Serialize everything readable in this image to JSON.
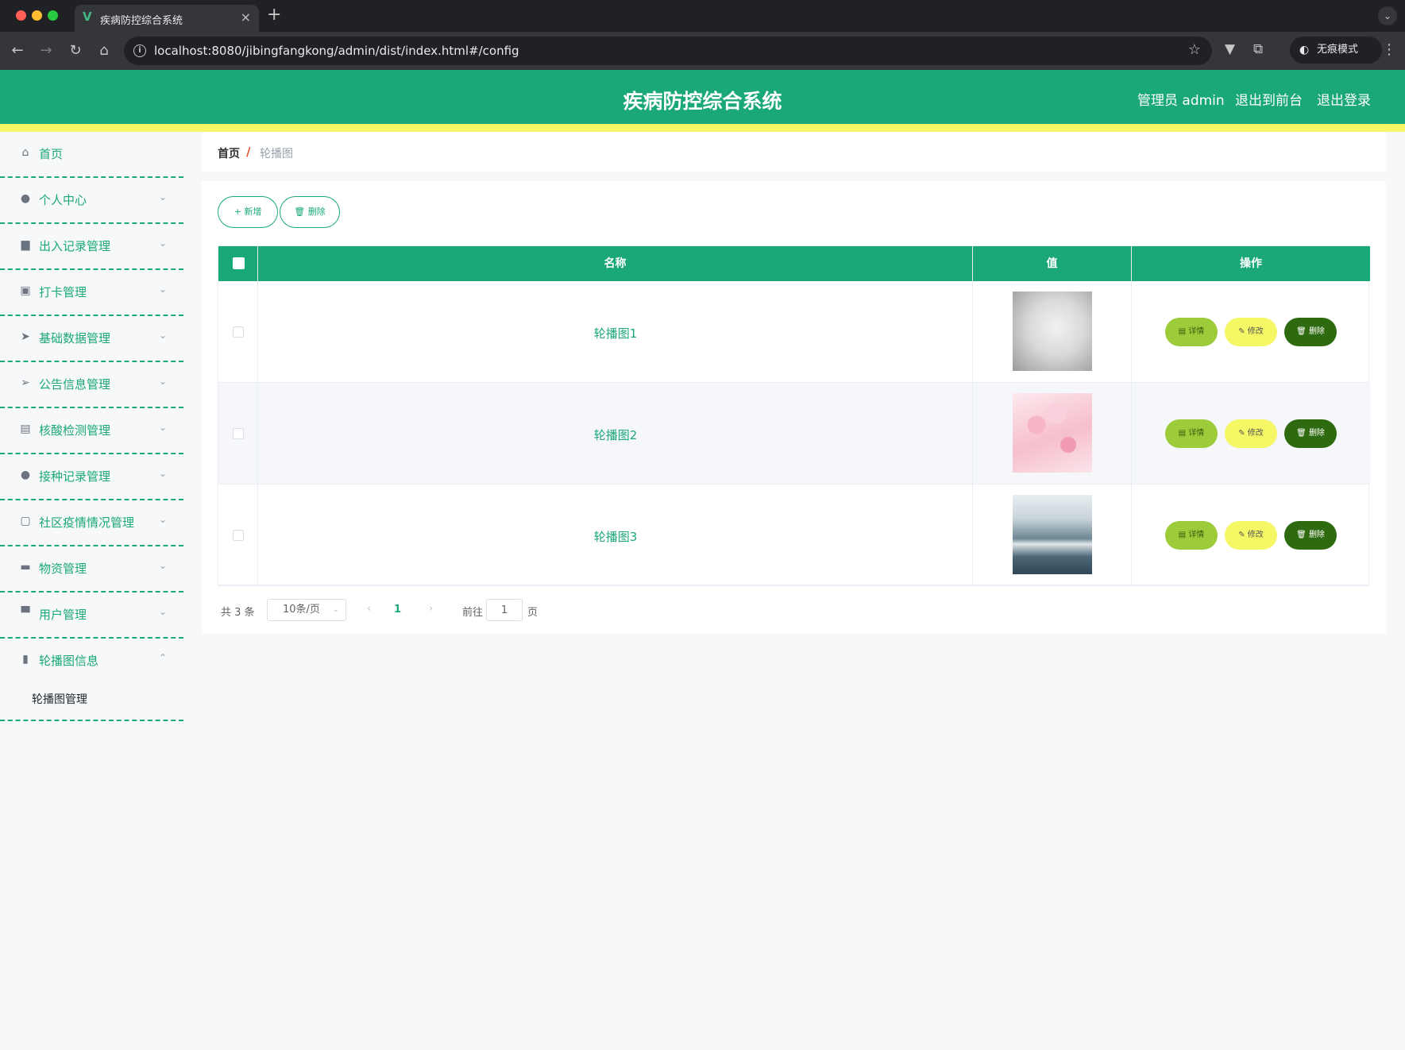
{
  "browser": {
    "tab_title": "疾病防控综合系统",
    "tab_favicon": "V",
    "url": "localhost:8080/jibingfangkong/admin/dist/index.html#/config",
    "incognito_label": "无痕模式",
    "icons": [
      "back-arrow-icon",
      "forward-arrow-icon",
      "reload-icon",
      "home-icon",
      "info-icon",
      "star-icon",
      "vue-devtools-icon",
      "extensions-icon",
      "incognito-icon",
      "kebab-menu-icon"
    ]
  },
  "header": {
    "title": "疾病防控综合系统",
    "admin_label": "管理员 admin",
    "front_label": "退出到前台",
    "logout_label": "退出登录",
    "colors": {
      "primary": "#1aa879",
      "stripe": "#f6f764"
    }
  },
  "sidebar": {
    "items": [
      {
        "label": "首页",
        "icon": "home-icon",
        "has_chevron": false
      },
      {
        "label": "个人中心",
        "icon": "user-icon",
        "chevron": "⌄"
      },
      {
        "label": "出入记录管理",
        "icon": "printer-icon",
        "chevron": "⌄"
      },
      {
        "label": "打卡管理",
        "icon": "wallet-icon",
        "chevron": "⌄"
      },
      {
        "label": "基础数据管理",
        "icon": "send-icon",
        "chevron": "⌄"
      },
      {
        "label": "公告信息管理",
        "icon": "paper-plane-icon",
        "chevron": "⌄"
      },
      {
        "label": "核酸检测管理",
        "icon": "briefcase-icon",
        "chevron": "⌄"
      },
      {
        "label": "接种记录管理",
        "icon": "user-icon",
        "chevron": "⌄"
      },
      {
        "label": "社区疫情情况管理",
        "icon": "chat-icon",
        "chevron": "⌄"
      },
      {
        "label": "物资管理",
        "icon": "message-icon",
        "chevron": "⌄"
      },
      {
        "label": "用户管理",
        "icon": "monitor-icon",
        "chevron": "⌄"
      },
      {
        "label": "轮播图信息",
        "icon": "bar-chart-icon",
        "chevron": "⌃"
      }
    ],
    "submenu": {
      "label": "轮播图管理"
    }
  },
  "breadcrumb": {
    "home": "首页",
    "separator": "/",
    "current": "轮播图"
  },
  "toolbar": {
    "add_label": "+ 新增",
    "delete_label": "删除",
    "delete_icon": "trash-icon"
  },
  "table": {
    "columns": [
      "名称",
      "值",
      "操作"
    ],
    "rows": [
      {
        "name": "轮播图1",
        "image": "misty-trees-thumbnail"
      },
      {
        "name": "轮播图2",
        "image": "pink-petals-thumbnail"
      },
      {
        "name": "轮播图3",
        "image": "misty-mountains-thumbnail"
      }
    ],
    "actions": {
      "detail": "详情",
      "edit": "修改",
      "delete": "删除"
    },
    "action_colors": {
      "detail": "#9ccc3a",
      "edit": "#f6f764",
      "delete": "#2e6a0f"
    }
  },
  "pagination": {
    "total": "共 3 条",
    "page_size": "10条/页",
    "current_page": "1",
    "goto_label": "前往",
    "goto_value": "1",
    "page_label": "页"
  }
}
